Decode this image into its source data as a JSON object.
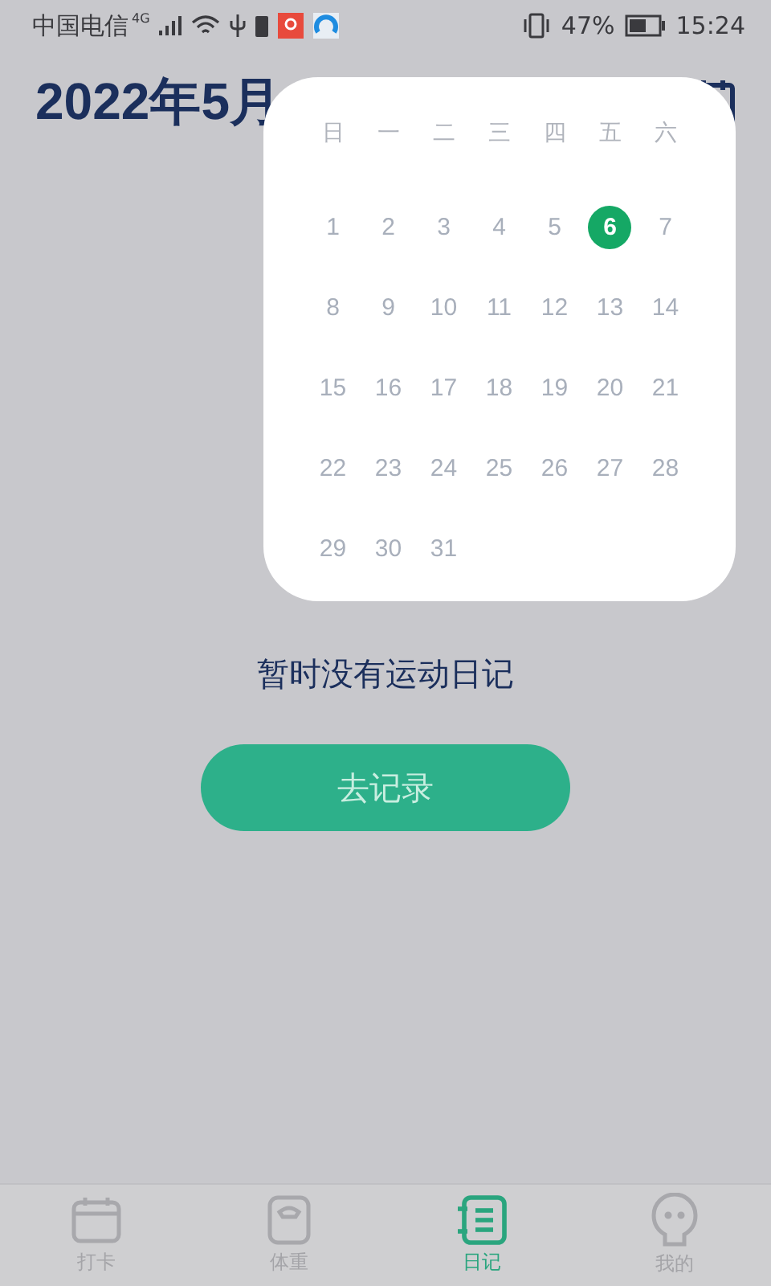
{
  "status_bar": {
    "carrier": "中国电信",
    "network": "4G",
    "battery": "47%",
    "time": "15:24"
  },
  "header": {
    "title": "2022年5月"
  },
  "calendar": {
    "weekdays": [
      "日",
      "一",
      "二",
      "三",
      "四",
      "五",
      "六"
    ],
    "days": [
      {
        "label": "1",
        "selected": false
      },
      {
        "label": "2",
        "selected": false
      },
      {
        "label": "3",
        "selected": false
      },
      {
        "label": "4",
        "selected": false
      },
      {
        "label": "5",
        "selected": false
      },
      {
        "label": "6",
        "selected": true
      },
      {
        "label": "7",
        "selected": false
      },
      {
        "label": "8",
        "selected": false
      },
      {
        "label": "9",
        "selected": false
      },
      {
        "label": "10",
        "selected": false
      },
      {
        "label": "11",
        "selected": false
      },
      {
        "label": "12",
        "selected": false
      },
      {
        "label": "13",
        "selected": false
      },
      {
        "label": "14",
        "selected": false
      },
      {
        "label": "15",
        "selected": false
      },
      {
        "label": "16",
        "selected": false
      },
      {
        "label": "17",
        "selected": false
      },
      {
        "label": "18",
        "selected": false
      },
      {
        "label": "19",
        "selected": false
      },
      {
        "label": "20",
        "selected": false
      },
      {
        "label": "21",
        "selected": false
      },
      {
        "label": "22",
        "selected": false
      },
      {
        "label": "23",
        "selected": false
      },
      {
        "label": "24",
        "selected": false
      },
      {
        "label": "25",
        "selected": false
      },
      {
        "label": "26",
        "selected": false
      },
      {
        "label": "27",
        "selected": false
      },
      {
        "label": "28",
        "selected": false
      },
      {
        "label": "29",
        "selected": false
      },
      {
        "label": "30",
        "selected": false
      },
      {
        "label": "31",
        "selected": false
      }
    ]
  },
  "empty_state": {
    "message": "暂时没有运动日记",
    "button": "去记录"
  },
  "tabs": [
    {
      "label": "打卡",
      "kind": "calendar",
      "selected": false
    },
    {
      "label": "体重",
      "kind": "scale",
      "selected": false
    },
    {
      "label": "日记",
      "kind": "diary",
      "selected": true
    },
    {
      "label": "我的",
      "kind": "profile",
      "selected": false
    }
  ]
}
